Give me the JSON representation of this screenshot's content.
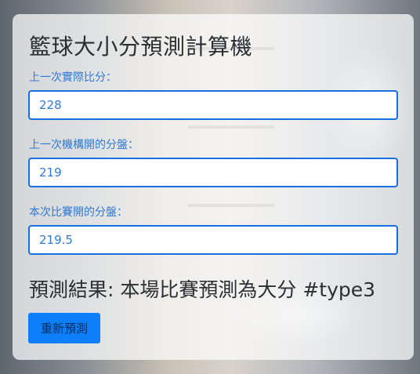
{
  "title": "籃球大小分預測計算機",
  "fields": [
    {
      "label": "上一次實際比分：",
      "value": "228"
    },
    {
      "label": "上一次機構開的分盤：",
      "value": "219"
    },
    {
      "label": "本次比賽開的分盤：",
      "value": "219.5"
    }
  ],
  "result": {
    "prefix": "預測結果: ",
    "text": "本場比賽預測為大分 #type3"
  },
  "button_label": "重新預測",
  "colors": {
    "accent": "#0d7ffb",
    "label": "#2f7ad6",
    "input_border": "#1a6fe0"
  }
}
